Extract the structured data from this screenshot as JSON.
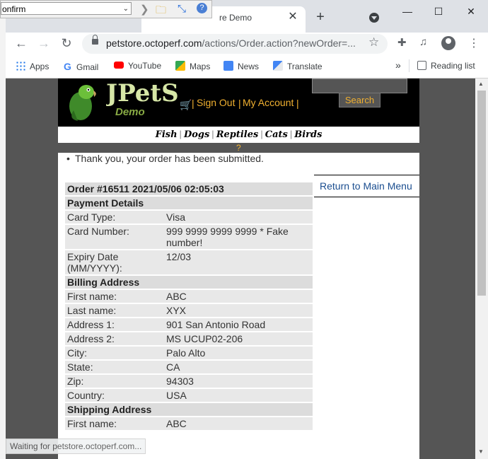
{
  "file_toolbar": {
    "input_value": "onfirm"
  },
  "browser": {
    "tab_title": "re Demo",
    "url_host": "petstore.octoperf.com",
    "url_path": "/actions/Order.action?newOrder=...",
    "bookmarks": [
      {
        "label": "Apps",
        "icon": "apps-grid-icon",
        "color": "#1a73e8"
      },
      {
        "label": "Gmail",
        "icon": "google-icon",
        "color": "#4285f4"
      },
      {
        "label": "YouTube",
        "icon": "youtube-icon",
        "color": "#ff0000"
      },
      {
        "label": "Maps",
        "icon": "maps-icon",
        "color": "#34a853"
      },
      {
        "label": "News",
        "icon": "news-icon",
        "color": "#4285f4"
      },
      {
        "label": "Translate",
        "icon": "translate-icon",
        "color": "#4285f4"
      }
    ],
    "more_bookmarks": "»",
    "reading_list": "Reading list",
    "status_text": "Waiting for petstore.octoperf.com..."
  },
  "store": {
    "logo_text": "JPetStore",
    "logo_sub": "Demo",
    "sign_out": "Sign Out",
    "my_account": "My Account",
    "search_button": "Search",
    "categories": [
      "Fish",
      "Dogs",
      "Reptiles",
      "Cats",
      "Birds"
    ],
    "help_mark": "?"
  },
  "order": {
    "message": "Thank you, your order has been submitted.",
    "title": "Order #16511 2021/05/06 02:05:03",
    "sections": {
      "payment": "Payment Details",
      "billing": "Billing Address",
      "shipping": "Shipping Address"
    },
    "payment_rows": [
      {
        "label": "Card Type:",
        "value": "Visa"
      },
      {
        "label": "Card Number:",
        "value": "999 9999 9999 9999 * Fake number!"
      },
      {
        "label": "Expiry Date (MM/YYYY):",
        "value": "12/03"
      }
    ],
    "billing_rows": [
      {
        "label": "First name:",
        "value": "ABC"
      },
      {
        "label": "Last name:",
        "value": "XYX"
      },
      {
        "label": "Address 1:",
        "value": "901 San Antonio Road"
      },
      {
        "label": "Address 2:",
        "value": "MS UCUP02-206"
      },
      {
        "label": "City:",
        "value": "Palo Alto"
      },
      {
        "label": "State:",
        "value": "CA"
      },
      {
        "label": "Zip:",
        "value": "94303"
      },
      {
        "label": "Country:",
        "value": "USA"
      }
    ],
    "shipping_rows": [
      {
        "label": "First name:",
        "value": "ABC"
      }
    ],
    "return_link": "Return to Main Menu"
  },
  "colors": {
    "store_accent": "#f0b030",
    "link_blue": "#1a4d8f",
    "header_bg": "#000000"
  }
}
